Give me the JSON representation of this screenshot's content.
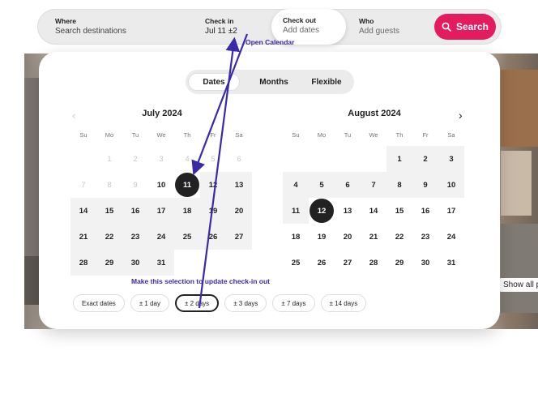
{
  "search": {
    "where_label": "Where",
    "where_value": "Search destinations",
    "checkin_label": "Check in",
    "checkin_value": "Jul 11  ±2",
    "checkout_label": "Check out",
    "checkout_value": "Add dates",
    "who_label": "Who",
    "who_value": "Add guests",
    "search_button": "Search"
  },
  "tabs": [
    "Dates",
    "Months",
    "Flexible"
  ],
  "weekdays": [
    "Su",
    "Mo",
    "Tu",
    "We",
    "Th",
    "Fr",
    "Sa"
  ],
  "months": [
    {
      "title": "July 2024",
      "days": [
        [
          "",
          "1",
          "2",
          "3",
          "4",
          "5",
          "6"
        ],
        [
          "7",
          "8",
          "9",
          "10",
          "11",
          "12",
          "13"
        ],
        [
          "14",
          "15",
          "16",
          "17",
          "18",
          "19",
          "20"
        ],
        [
          "21",
          "22",
          "23",
          "24",
          "25",
          "26",
          "27"
        ],
        [
          "28",
          "29",
          "30",
          "31",
          "",
          "",
          ""
        ]
      ]
    },
    {
      "title": "August 2024",
      "days": [
        [
          "",
          "",
          "",
          "",
          "1",
          "2",
          "3"
        ],
        [
          "4",
          "5",
          "6",
          "7",
          "8",
          "9",
          "10"
        ],
        [
          "11",
          "12",
          "13",
          "14",
          "15",
          "16",
          "17"
        ],
        [
          "18",
          "19",
          "20",
          "21",
          "22",
          "23",
          "24"
        ],
        [
          "25",
          "26",
          "27",
          "28",
          "29",
          "30",
          "31"
        ]
      ]
    }
  ],
  "chips": [
    "Exact dates",
    "± 1 day",
    "± 2 days",
    "± 3 days",
    "± 7 days",
    "± 14 days"
  ],
  "active_chip": "± 2 days",
  "annotations": {
    "open_calendar": "Open Calendar",
    "make_selection": "Make this selection to update check-in out"
  },
  "background": {
    "show_photos": "Show all photos"
  },
  "colors": {
    "brand": "#e31c5f",
    "annotation": "#3a2aa8"
  }
}
